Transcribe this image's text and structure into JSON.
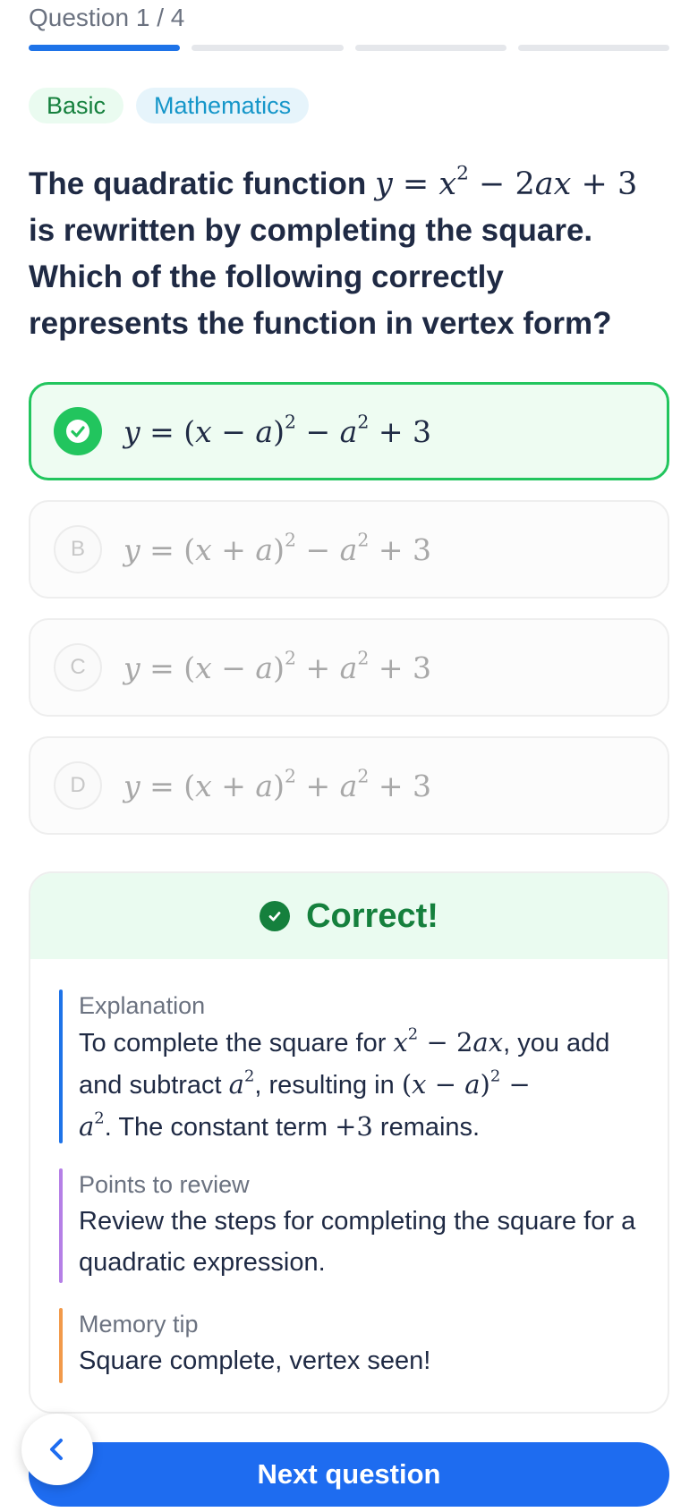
{
  "progress": {
    "label": "Question 1 / 4",
    "current": 1,
    "total": 4
  },
  "tags": {
    "level": "Basic",
    "subject": "Mathematics"
  },
  "question": {
    "text": "The quadratic function y = x^2 − 2ax + 3 is rewritten by completing the square. Which of the following correctly represents the function in vertex form?"
  },
  "options": [
    {
      "letter": "A",
      "formula": "y = (x − a)^2 − a^2 + 3",
      "selected": true
    },
    {
      "letter": "B",
      "formula": "y = (x + a)^2 − a^2 + 3",
      "selected": false
    },
    {
      "letter": "C",
      "formula": "y = (x − a)^2 + a^2 + 3",
      "selected": false
    },
    {
      "letter": "D",
      "formula": "y = (x + a)^2 + a^2 + 3",
      "selected": false
    }
  ],
  "feedback": {
    "title": "Correct!",
    "sections": [
      {
        "title": "Explanation",
        "body": "To complete the square for x^2 − 2ax, you add and subtract a^2, resulting in (x − a)^2 − a^2. The constant term +3 remains.",
        "color": "#1e73e8"
      },
      {
        "title": "Points to review",
        "body": "Review the steps for completing the square for a quadratic expression.",
        "color": "#b57fe6"
      },
      {
        "title": "Memory tip",
        "body": "Square complete, vertex seen!",
        "color": "#f29a4a"
      }
    ]
  },
  "nav": {
    "next_label": "Next question",
    "back_icon": "chevron-left-icon"
  },
  "colors": {
    "accent": "#1e6cf0",
    "correct": "#22c55e",
    "correct_dark": "#15803d"
  }
}
